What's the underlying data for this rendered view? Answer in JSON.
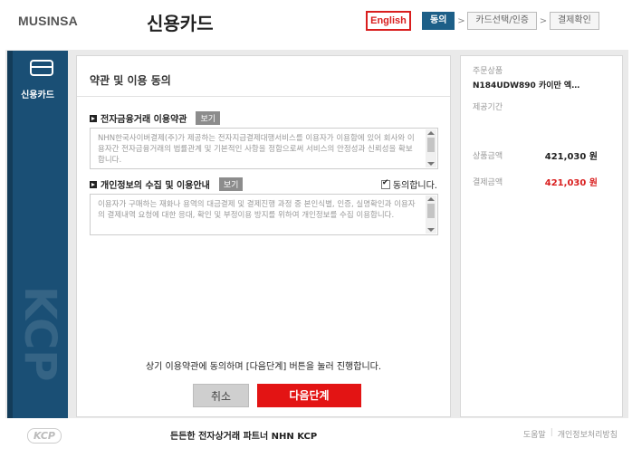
{
  "header": {
    "brand": "MUSINSA",
    "title": "신용카드",
    "lang_button": "English",
    "steps": [
      {
        "label": "동의",
        "active": true
      },
      {
        "label": "카드선택/인증",
        "active": false
      },
      {
        "label": "결제확인",
        "active": false
      }
    ],
    "step_separator": ">"
  },
  "sidebar": {
    "label": "신용카드",
    "watermark": "KCP"
  },
  "main": {
    "title": "약관 및 이용 동의",
    "section1": {
      "title": "전자금융거래 이용약관",
      "view_button": "보기",
      "text": "NHN한국사이버결제(주)가 제공하는 전자지급결제대행서비스를 이용자가 이용함에 있어 회사와 이용자간 전자금융거래의 법률관계 및 기본적인 사항을 정함으로써 서비스의 안정성과 신뢰성을 확보합니다."
    },
    "section2": {
      "title": "개인정보의 수집 및 이용안내",
      "view_button": "보기",
      "agree_label": "동의합니다.",
      "text": "이용자가 구매하는 재화나 용역의 대금결제 및 결제진행 과정 중 본인식별, 인증, 실명확인과 이용자의 결제내역 요청에 대한 응대, 확인 및 부정이용 방지를 위하여 개인정보를 수집 이용합니다."
    },
    "notice": "상기 이용약관에 동의하며 [다음단계] 버튼을 눌러 진행합니다.",
    "cancel_button": "취소",
    "next_button": "다음단계"
  },
  "summary": {
    "order_label": "주문상품",
    "product": "N184UDW890 카이만 엑…",
    "period_label": "제공기간",
    "price_label": "상품금액",
    "price_value": "421,030 원",
    "pay_label": "결제금액",
    "pay_value": "421,030 원"
  },
  "footer": {
    "logo": "KCP",
    "text": "든든한 전자상거래 파트너 NHN KCP",
    "help": "도움말",
    "privacy": "개인정보처리방침",
    "link_sep": "|"
  },
  "colors": {
    "accent_red": "#e31414",
    "sidebar_blue": "#1a4f75",
    "step_active": "#1d5f88"
  }
}
